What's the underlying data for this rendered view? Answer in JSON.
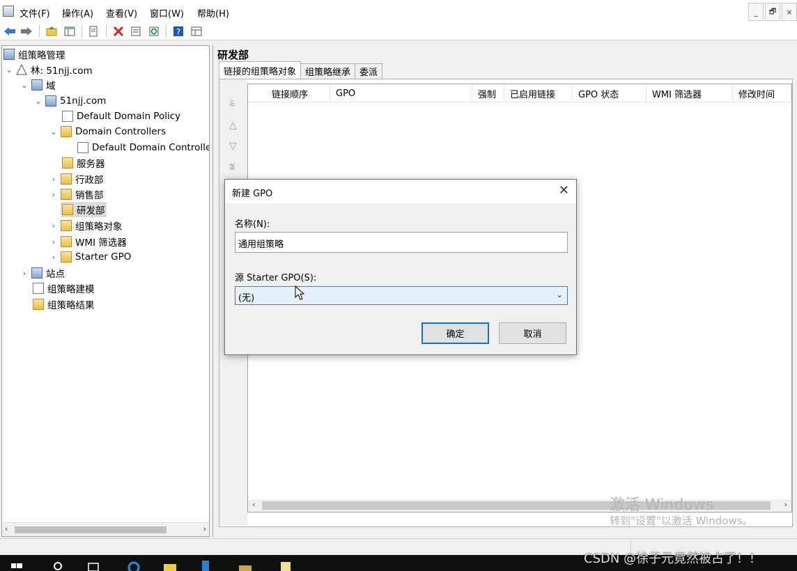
{
  "menu": {
    "items": [
      "文件(F)",
      "操作(A)",
      "查看(V)",
      "窗口(W)",
      "帮助(H)"
    ]
  },
  "window_buttons": {
    "minimize": "_",
    "restore": "🗗",
    "close": "×"
  },
  "toolbar": {
    "icons": [
      "back-arrow-icon",
      "forward-arrow-icon",
      "up-folder-icon",
      "show-hide-tree-icon",
      "copy-icon",
      "delete-icon",
      "properties-icon",
      "refresh-icon",
      "help-icon",
      "view-icon"
    ]
  },
  "tree": {
    "root": "组策略管理",
    "forest": "林: 51njj.com",
    "domains": "域",
    "domain": "51njj.com",
    "default_domain_policy": "Default Domain Policy",
    "domain_controllers": "Domain Controllers",
    "default_dc_policy": "Default Domain Controlle",
    "servers": "服务器",
    "admin": "行政部",
    "sales": "销售部",
    "rnd": "研发部",
    "gpo_objects": "组策略对象",
    "wmi_filters": "WMI 筛选器",
    "starter_gpo": "Starter GPO",
    "sites": "站点",
    "modeling": "组策略建模",
    "results": "组策略结果"
  },
  "right": {
    "title": "研发部",
    "tabs": [
      "链接的组策略对象",
      "组策略继承",
      "委派"
    ],
    "columns": [
      "链接顺序",
      "GPO",
      "强制",
      "已启用链接",
      "GPO 状态",
      "WMI 筛选器",
      "修改时间"
    ]
  },
  "watermark": {
    "line1": "激活 Windows",
    "line2": "转到\"设置\"以激活 Windows。"
  },
  "dialog": {
    "title": "新建 GPO",
    "name_label": "名称(N):",
    "name_value": "通用组策略",
    "source_label": "源 Starter GPO(S):",
    "source_value": "(无)",
    "ok": "确定",
    "cancel": "取消"
  },
  "overlay": {
    "csdn": "CSDN @徐子元竟然被占了！！"
  }
}
